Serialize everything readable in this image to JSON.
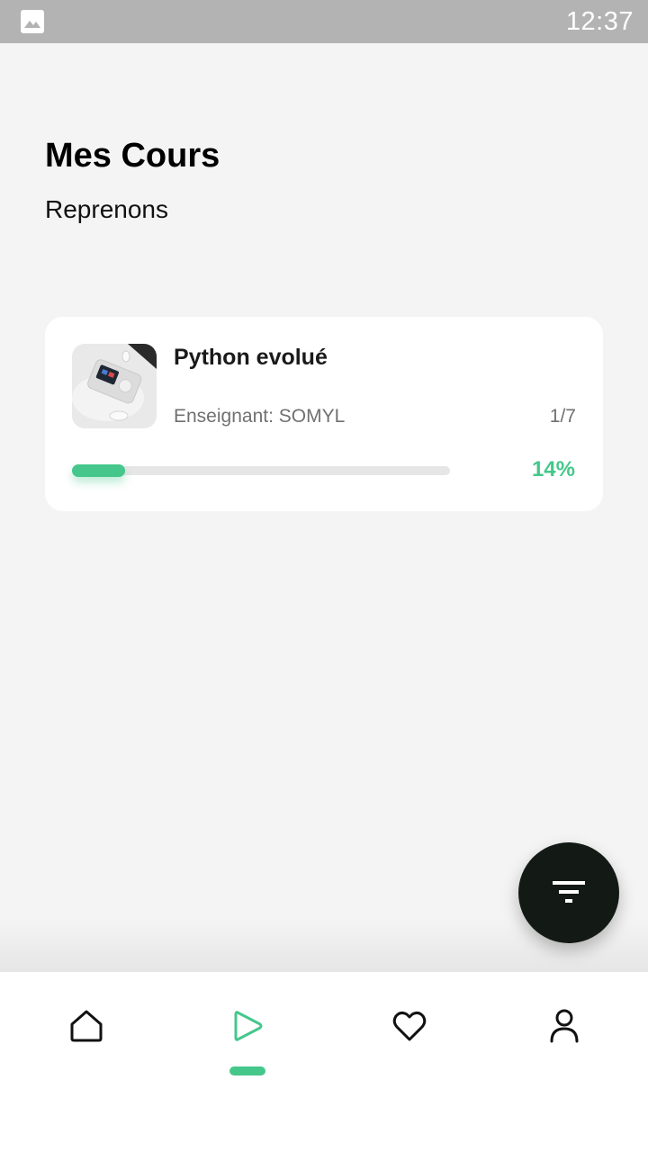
{
  "status_bar": {
    "time": "12:37",
    "left_icon": "image-icon"
  },
  "header": {
    "title": "Mes Cours",
    "subtitle": "Reprenons"
  },
  "courses": [
    {
      "title": "Python evolué",
      "teacher": "Enseignant: SOMYL",
      "lessons": "1/7",
      "progress_label": "14%",
      "progress": 0.14,
      "thumbnail": "device-with-earbuds-image"
    }
  ],
  "fab": {
    "icon": "filter-icon"
  },
  "bottom_nav": {
    "items": [
      {
        "icon": "home-icon",
        "active": false
      },
      {
        "icon": "play-icon",
        "active": true
      },
      {
        "icon": "heart-icon",
        "active": false
      },
      {
        "icon": "profile-icon",
        "active": false
      }
    ]
  },
  "colors": {
    "accent": "#45c78b",
    "background": "#f4f4f4",
    "status_bar": "#b3b3b3",
    "fab": "#131a15"
  }
}
